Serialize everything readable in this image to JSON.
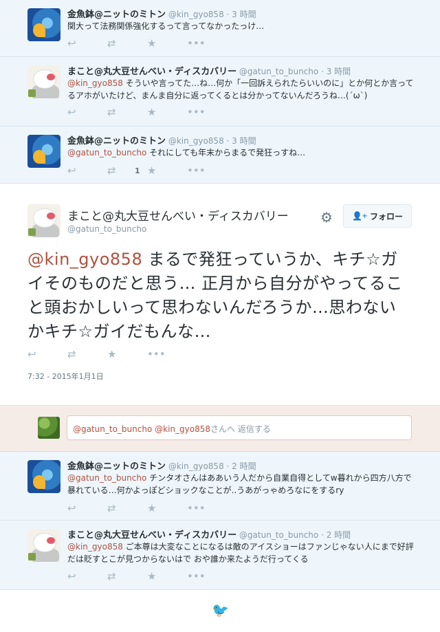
{
  "tweets_before": [
    {
      "fullname": "金魚鉢@ニットのミトン",
      "username": "@kin_gyo858",
      "time": "· 3 時間",
      "avatar": "goldfish-avatar",
      "text_parts": [
        {
          "type": "text",
          "value": "関大って法務関係強化するって言ってなかったっけ…"
        }
      ],
      "retweet_count": ""
    },
    {
      "fullname": "まこと@丸大豆せんべい・ディスカバリー",
      "username": "@gatun_to_buncho",
      "time": "· 3 時間",
      "avatar": "bird-avatar",
      "text_parts": [
        {
          "type": "mention",
          "value": "@kin_gyo858"
        },
        {
          "type": "text",
          "value": " そういや言ってた…ね…何か「一回訴えられたらいいのに」とか何とか言ってるアホがいたけど、まんま自分に返ってくるとは分かってないんだろうね…(´ω`)"
        }
      ],
      "retweet_count": ""
    },
    {
      "fullname": "金魚鉢@ニットのミトン",
      "username": "@kin_gyo858",
      "time": "· 3 時間",
      "avatar": "goldfish-avatar",
      "text_parts": [
        {
          "type": "mention",
          "value": "@gatun_to_buncho"
        },
        {
          "type": "text",
          "value": " それにしても年末からまるで発狂っすね…"
        }
      ],
      "retweet_count": "1"
    }
  ],
  "focus": {
    "fullname": "まこと@丸大豆せんべい・ディスカバリー",
    "username": "@gatun_to_buncho",
    "follow_label": "フォロー",
    "mention": "@kin_gyo858",
    "text": " まるで発狂っていうか、キチ☆ガイそのものだと思う… 正月から自分がやってること頭おかしいって思わないんだろうか…思わないかキチ☆ガイだもんな…",
    "timestamp": "7:32 - 2015年1月1日"
  },
  "reply_box": {
    "mention1": "@gatun_to_buncho",
    "mention2": "@kin_gyo858",
    "suffix": "さんへ 返信する"
  },
  "tweets_after": [
    {
      "fullname": "金魚鉢@ニットのミトン",
      "username": "@kin_gyo858",
      "time": "· 2 時間",
      "avatar": "goldfish-avatar",
      "text_parts": [
        {
          "type": "mention",
          "value": "@gatun_to_buncho"
        },
        {
          "type": "text",
          "value": " チンタオさんはああいう人だから自業自得としてw暮れから四方八方で暴れている…何かよっぽどショックなことが..うあがっゃめろなにをするry"
        }
      ],
      "retweet_count": ""
    },
    {
      "fullname": "まこと@丸大豆せんべい・ディスカバリー",
      "username": "@gatun_to_buncho",
      "time": "· 2 時間",
      "avatar": "bird-avatar",
      "text_parts": [
        {
          "type": "mention",
          "value": "@kin_gyo858"
        },
        {
          "type": "text",
          "value": " ご本尊は大変なことになるは敵のアイスショーはファンじゃない人にまで好評だは貶すとこが見つからないはで おや誰か来たようだ行ってくる"
        }
      ],
      "retweet_count": ""
    }
  ],
  "icons": {
    "reply": "reply-icon",
    "retweet": "retweet-icon",
    "favorite": "star-icon",
    "more": "more-icon",
    "settings": "gear-icon",
    "follow": "add-person-icon",
    "footer": "twitter-bird-icon"
  },
  "colors": {
    "mention": "#b0513f",
    "tweet_bg": "#eef6fb",
    "reply_bar_bg": "#f5ece8"
  }
}
